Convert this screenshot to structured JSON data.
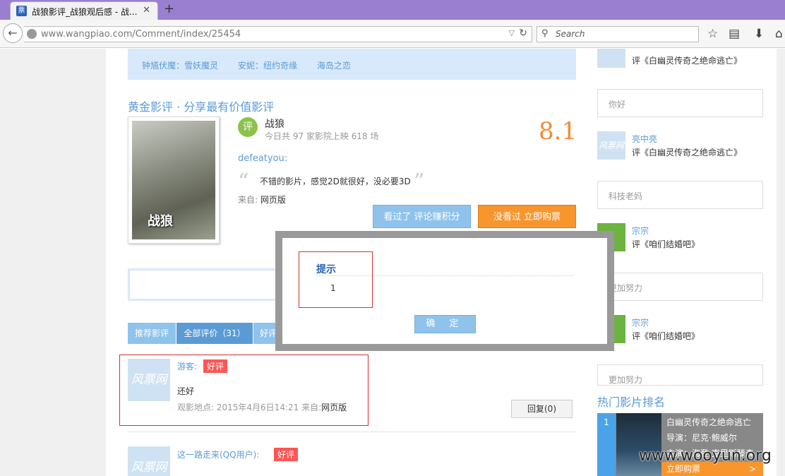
{
  "browser": {
    "tab_title": "战狼影评_战狼观后感 - 战...",
    "url_host": "www.wangpiao.com",
    "url_path": "/Comment/index/25454",
    "search_placeholder": "Search",
    "fav_char": "票"
  },
  "page": {
    "banner_links": [
      "钟馗伏魔：雪妖魔灵",
      "安妮：纽约奇缘",
      "海岛之恋"
    ],
    "section_title": "黄金影评 · 分享最有价值影评",
    "poster_title": "战狼",
    "badge": "评",
    "movie_name": "战狼",
    "movie_stats": "今日共 97 家影院上映 618 场",
    "score": "8.1",
    "comment_user": "defeatyou:",
    "comment_text": "不错的影片，感觉2D就很好，没必要3D",
    "from_label": "来自:",
    "from_value": "网页版",
    "btn_seen": "看过了 评论赚积分",
    "btn_buy": "没看过 立即购票",
    "tabs": [
      "推荐影评",
      "全部评价（31）",
      "好评"
    ],
    "review1": {
      "name": "游客:",
      "tag": "好评",
      "text": "还好",
      "meta_label": "观影地点:",
      "meta_time": "2015年4月6日14:21 来自:",
      "meta_from": "网页版",
      "reply": "回复(0)"
    },
    "review2": {
      "name": "这一路走来(QQ用户):",
      "tag": "好评"
    },
    "logo_text": "风票网"
  },
  "sidebar": {
    "top_comment": "评《白幽灵传奇之绝命逃亡》",
    "items": [
      {
        "box": "你好",
        "name": "亮中亮",
        "comment": "评《白幽灵传奇之绝命逃亡》"
      },
      {
        "box": "科技老妈",
        "name": "宗宗",
        "comment": "评《咱们结婚吧》"
      },
      {
        "box": "更加努力",
        "name": "宗宗",
        "comment": "评《咱们结婚吧》"
      },
      {
        "box": "更加努力"
      }
    ],
    "hot_title": "热门影片排名",
    "hot": {
      "rank": "1",
      "title": "白幽灵传奇之绝命逃亡",
      "director": "导演：尼克·鲍威尔",
      "cast": "主演：海登·克里斯滕森",
      "buy": "立即购票",
      "arrow": ">"
    }
  },
  "dialog": {
    "title": "提示",
    "message": "1",
    "ok": "确 定"
  },
  "watermark": "www.wooyun.org"
}
